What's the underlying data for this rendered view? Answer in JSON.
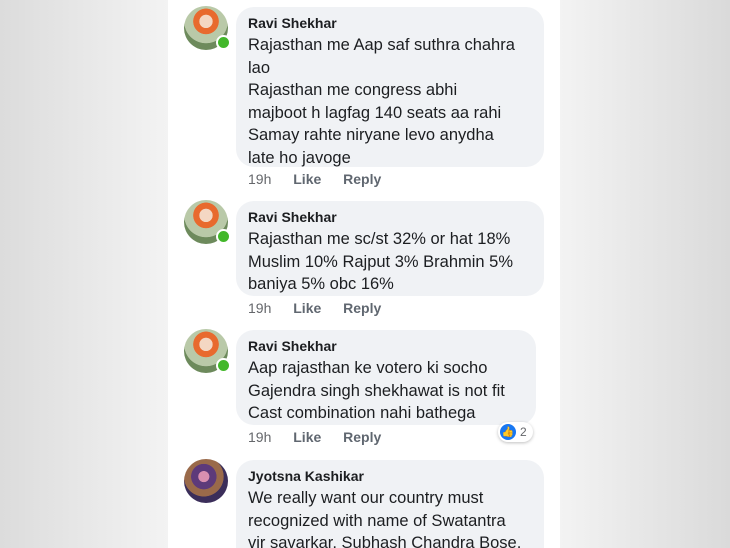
{
  "comments": [
    {
      "author": "Ravi Shekhar",
      "text": "Rajasthan me Aap saf suthra chahra\nlao\nRajasthan me congress abhi\nmajboot h lagfag 140 seats aa rahi\nSamay rahte niryane levo anydha\nlate ho javoge",
      "time": "19h",
      "like": "Like",
      "reply": "Reply"
    },
    {
      "author": "Ravi Shekhar",
      "text": "Rajasthan me sc/st 32% or hat 18%\nMuslim 10% Rajput 3% Brahmin 5%\nbaniya 5% obc 16%",
      "time": "19h",
      "like": "Like",
      "reply": "Reply"
    },
    {
      "author": "Ravi Shekhar",
      "text": "Aap rajasthan ke votero ki socho\nGajendra singh shekhawat is not fit\nCast combination nahi bathega",
      "time": "19h",
      "like": "Like",
      "reply": "Reply",
      "reaction_count": "2"
    },
    {
      "author": "Jyotsna Kashikar",
      "text": "We really want our country must\nrecognized with name of  Swatantra\nvir savarkar, Subhash Chandra Bose,"
    }
  ],
  "colors": {
    "online": "#42b72a",
    "like": "#1877f2",
    "bubble": "#f0f2f5"
  },
  "icons": {
    "reaction": "thumbs-up-icon"
  }
}
